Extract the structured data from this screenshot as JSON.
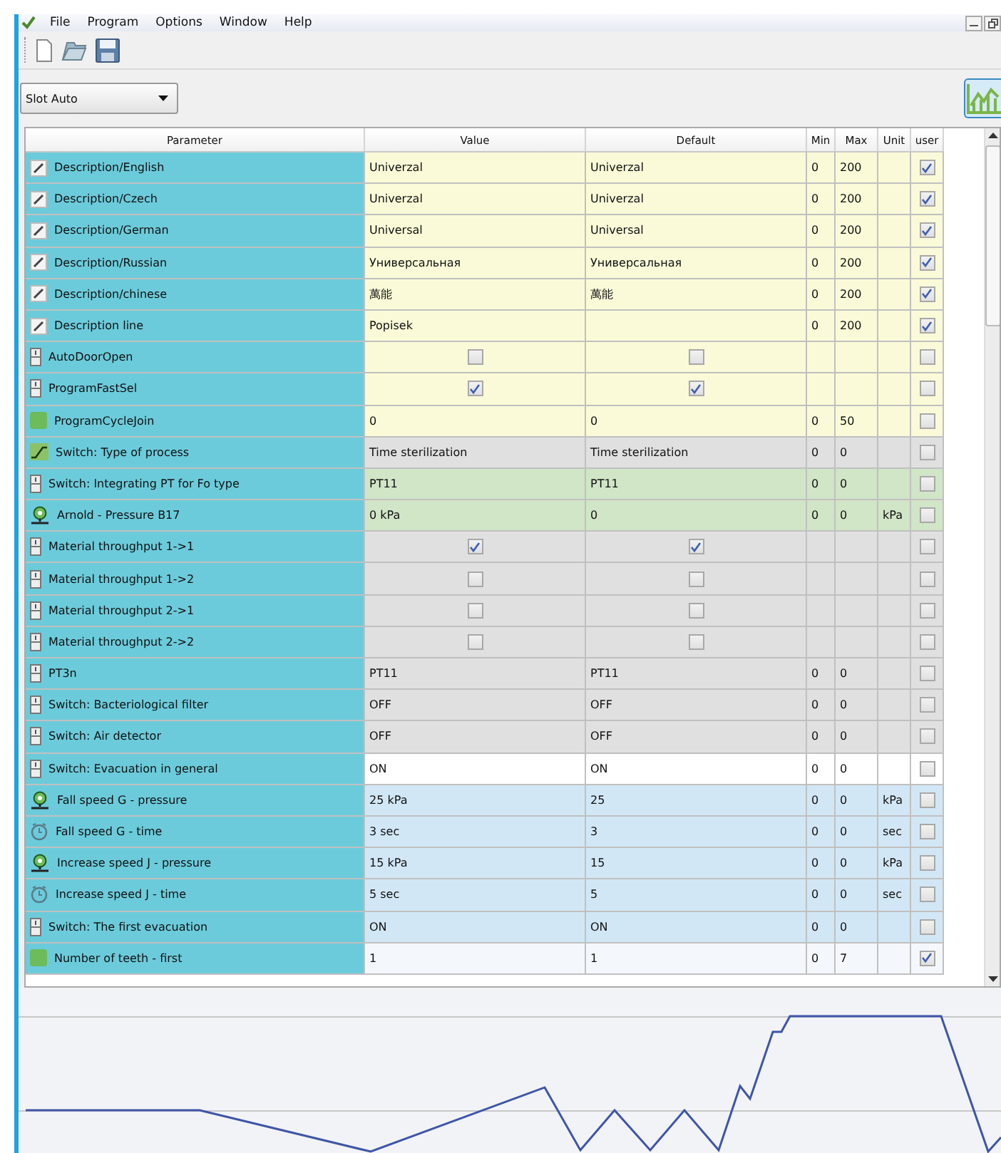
{
  "menu": [
    "File",
    "Program",
    "Options",
    "Window",
    "Help"
  ],
  "slot_select": {
    "value": "Slot Auto"
  },
  "table": {
    "columns": [
      "Parameter",
      "Value",
      "Default",
      "Min",
      "Max",
      "Unit",
      "user"
    ],
    "rows": [
      {
        "kind": "edit",
        "parameter": "Description/English",
        "value": "Univerzal",
        "default": "Univerzal",
        "min": "0",
        "max": "200",
        "user": true,
        "color": "#fafad8"
      },
      {
        "kind": "edit",
        "parameter": "Description/Czech",
        "value": "Univerzal",
        "default": "Univerzal",
        "min": "0",
        "max": "200",
        "user": true,
        "color": "#fafad8"
      },
      {
        "kind": "edit",
        "parameter": "Description/German",
        "value": "Universal",
        "default": "Universal",
        "min": "0",
        "max": "200",
        "user": true,
        "color": "#fafad8"
      },
      {
        "kind": "edit",
        "parameter": "Description/Russian",
        "value": "Универсальная",
        "default": "Универсальная",
        "min": "0",
        "max": "200",
        "user": true,
        "color": "#fafad8"
      },
      {
        "kind": "edit",
        "parameter": "Description/chinese",
        "value": "萬能",
        "default": "萬能",
        "min": "0",
        "max": "200",
        "user": true,
        "color": "#fafad8"
      },
      {
        "kind": "edit",
        "parameter": "Description line",
        "value": "Popisek",
        "min": "0",
        "max": "200",
        "user": true,
        "color": "#fafad8"
      },
      {
        "kind": "switch",
        "parameter": "AutoDoorOpen",
        "value_checked": false,
        "default_checked": false,
        "user": false,
        "color": "#fafad8"
      },
      {
        "kind": "switch",
        "parameter": "ProgramFastSel",
        "value_checked": true,
        "default_checked": true,
        "user": false,
        "color": "#fafad8"
      },
      {
        "kind": "block",
        "parameter": "ProgramCycleJoin",
        "value": "0",
        "default": "0",
        "min": "0",
        "max": "50",
        "user": false,
        "color": "#fafad8"
      },
      {
        "kind": "process",
        "parameter": "Switch: Type of process",
        "value": "Time sterilization",
        "default": "Time sterilization",
        "min": "0",
        "max": "0",
        "user": false,
        "color": "#e0e0e0"
      },
      {
        "kind": "switch",
        "parameter": "Switch: Integrating PT for Fo type",
        "value": "PT11",
        "default": "PT11",
        "min": "0",
        "max": "0",
        "user": false,
        "color": "#d1e5c7"
      },
      {
        "kind": "gauge",
        "parameter": "Arnold - Pressure B17",
        "value": "0 kPa",
        "default": "0",
        "min": "0",
        "max": "0",
        "unit": "kPa",
        "user": false,
        "color": "#d1e5c7"
      },
      {
        "kind": "switch",
        "parameter": "Material throughput 1->1",
        "value_checked": true,
        "default_checked": true,
        "user": false,
        "color": "#e0e0e0"
      },
      {
        "kind": "switch",
        "parameter": "Material throughput 1->2",
        "value_checked": false,
        "default_checked": false,
        "user": false,
        "color": "#e0e0e0"
      },
      {
        "kind": "switch",
        "parameter": "Material throughput 2->1",
        "value_checked": false,
        "default_checked": false,
        "user": false,
        "color": "#e0e0e0"
      },
      {
        "kind": "switch",
        "parameter": "Material throughput 2->2",
        "value_checked": false,
        "default_checked": false,
        "user": false,
        "color": "#e0e0e0"
      },
      {
        "kind": "switch",
        "parameter": "PT3n",
        "value": "PT11",
        "default": "PT11",
        "min": "0",
        "max": "0",
        "user": false,
        "color": "#e0e0e0"
      },
      {
        "kind": "switch",
        "parameter": "Switch: Bacteriological filter",
        "value": "OFF",
        "default": "OFF",
        "min": "0",
        "max": "0",
        "user": false,
        "color": "#e0e0e0"
      },
      {
        "kind": "switch",
        "parameter": "Switch: Air detector",
        "value": "OFF",
        "default": "OFF",
        "min": "0",
        "max": "0",
        "user": false,
        "color": "#e0e0e0"
      },
      {
        "kind": "switch",
        "parameter": "Switch: Evacuation in general",
        "value": "ON",
        "default": "ON",
        "min": "0",
        "max": "0",
        "user": false,
        "color": "#ffffff"
      },
      {
        "kind": "gauge",
        "parameter": "Fall speed G - pressure",
        "value": "25 kPa",
        "default": "25",
        "min": "0",
        "max": "0",
        "unit": "kPa",
        "user": false,
        "color": "#d2e7f5"
      },
      {
        "kind": "clock",
        "parameter": "Fall speed G - time",
        "value": "3 sec",
        "default": "3",
        "min": "0",
        "max": "0",
        "unit": "sec",
        "user": false,
        "color": "#d2e7f5"
      },
      {
        "kind": "gauge",
        "parameter": "Increase speed J  - pressure",
        "value": "15 kPa",
        "default": "15",
        "min": "0",
        "max": "0",
        "unit": "kPa",
        "user": false,
        "color": "#d2e7f5"
      },
      {
        "kind": "clock",
        "parameter": "Increase speed J  - time",
        "value": "5 sec",
        "default": "5",
        "min": "0",
        "max": "0",
        "unit": "sec",
        "user": false,
        "color": "#d2e7f5"
      },
      {
        "kind": "switch",
        "parameter": "Switch: The first evacuation",
        "value": "ON",
        "default": "ON",
        "min": "0",
        "max": "0",
        "user": false,
        "color": "#d2e7f5"
      },
      {
        "kind": "block",
        "parameter": "Number of teeth - first",
        "value": "1",
        "default": "1",
        "min": "0",
        "max": "7",
        "user": true,
        "color": "#f4f8fc"
      }
    ]
  }
}
